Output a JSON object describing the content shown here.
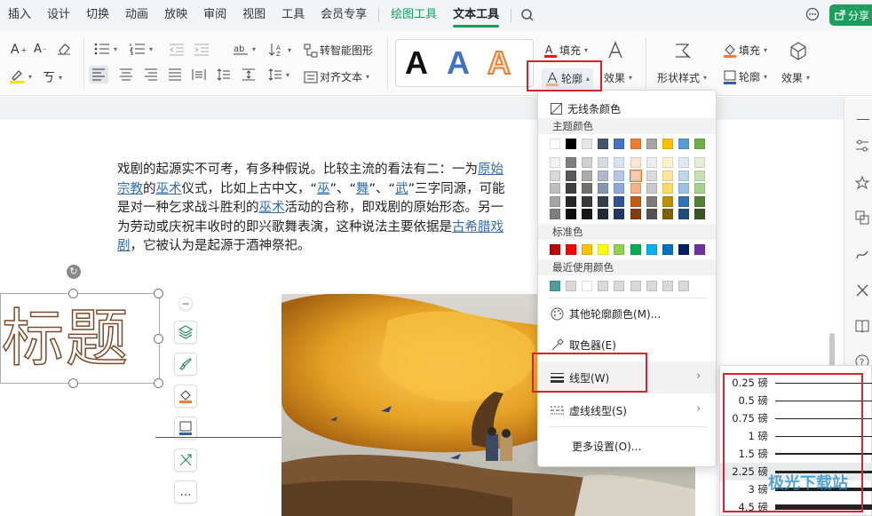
{
  "menubar": {
    "tabs": [
      "插入",
      "设计",
      "切换",
      "动画",
      "放映",
      "审阅",
      "视图",
      "工具",
      "会员专享"
    ],
    "context_tabs": [
      "绘图工具",
      "文本工具"
    ],
    "share_label": "分享"
  },
  "toolbar": {
    "smart_shape": "转智能图形",
    "align_text": "对齐文本",
    "fill": "填充",
    "outline": "轮廓",
    "effect": "效果",
    "shape_style": "形状样式",
    "shape_fill": "填充",
    "shape_outline": "轮廓",
    "shape_effect": "效果",
    "gallery_letters": [
      "A",
      "A",
      "A"
    ]
  },
  "document": {
    "para": {
      "s1": "戏剧的起源实不可考，有多种假说。比较主流的看法有二：一为",
      "l1": "原始宗教",
      "s2": "的",
      "l2": "巫术",
      "s3": "仪式，比如上古中文，“",
      "l3": "巫",
      "s4": "”、“",
      "l4": "舞",
      "s5": "”、“",
      "l5": "武",
      "s6": "”三字同源，可能是对一种乞求战斗胜利的",
      "l6": "巫术",
      "s7": "活动的合称，即戏剧的原始形态。另一为劳动或庆祝丰收时的即兴歌舞表演，这种说法主要依据是",
      "l7": "古希腊戏剧",
      "s8": "，它被认为是起源于酒神祭祀。"
    },
    "title_placeholder": "标题"
  },
  "dropdown": {
    "no_line": "无线条颜色",
    "theme_colors_header": "主题颜色",
    "standard_colors_header": "标准色",
    "recent_colors_header": "最近使用颜色",
    "more_colors": "其他轮廓颜色(M)...",
    "eyedropper": "取色器(E)",
    "line_style": "线型(W)",
    "dash_style": "虚线线型(S)",
    "more_settings": "更多设置(O)...",
    "theme_top": [
      "#ffffff",
      "#000000",
      "#e7e6e6",
      "#44546a",
      "#4472c4",
      "#ed7d31",
      "#a5a5a5",
      "#ffc000",
      "#5b9bd5",
      "#70ad47"
    ],
    "theme_shades": [
      [
        "#f2f2f2",
        "#7f7f7f",
        "#d0cece",
        "#d6dce4",
        "#d9e2f3",
        "#fbe5d5",
        "#ededed",
        "#fff2cc",
        "#deebf6",
        "#e2efd9"
      ],
      [
        "#d8d8d8",
        "#595959",
        "#aeabab",
        "#adb9ca",
        "#b4c6e7",
        "#f7cbac",
        "#dbdbdb",
        "#fee599",
        "#bdd7ee",
        "#c5e0b3"
      ],
      [
        "#bfbfbf",
        "#3f3f3f",
        "#757070",
        "#8496b0",
        "#8eaadb",
        "#f4b183",
        "#c9c9c9",
        "#ffd966",
        "#9cc3e5",
        "#a8d08d"
      ],
      [
        "#a5a5a5",
        "#262626",
        "#3a3838",
        "#323f4f",
        "#2f5496",
        "#c55a11",
        "#7b7b7b",
        "#bf9000",
        "#2e75b5",
        "#538135"
      ],
      [
        "#7f7f7f",
        "#0c0c0c",
        "#171616",
        "#222a35",
        "#1f3864",
        "#833c0b",
        "#525252",
        "#7f6000",
        "#1e4e79",
        "#375623"
      ]
    ],
    "standard": [
      "#c00000",
      "#ff0000",
      "#ffc000",
      "#ffff00",
      "#92d050",
      "#00b050",
      "#00b0f0",
      "#0070c0",
      "#002060",
      "#7030a0"
    ],
    "recent": [
      "#4f9c9c",
      "#d9d9d9",
      "#ffffff",
      "#d9d9d9",
      "#d9d9d9",
      "#d9d9d9",
      "#d9d9d9",
      "#d9d9d9",
      "#d9d9d9"
    ]
  },
  "submenu": {
    "weights": [
      {
        "label": "0.25 磅",
        "pt": 0.25
      },
      {
        "label": "0.5 磅",
        "pt": 0.5
      },
      {
        "label": "0.75 磅",
        "pt": 0.75
      },
      {
        "label": "1 磅",
        "pt": 1
      },
      {
        "label": "1.5 磅",
        "pt": 1.5
      },
      {
        "label": "2.25 磅",
        "pt": 2.25
      },
      {
        "label": "3 磅",
        "pt": 3
      },
      {
        "label": "4.5 磅",
        "pt": 4.5
      }
    ],
    "highlighted_label": "2.25 磅"
  },
  "watermark": "极光下载站"
}
